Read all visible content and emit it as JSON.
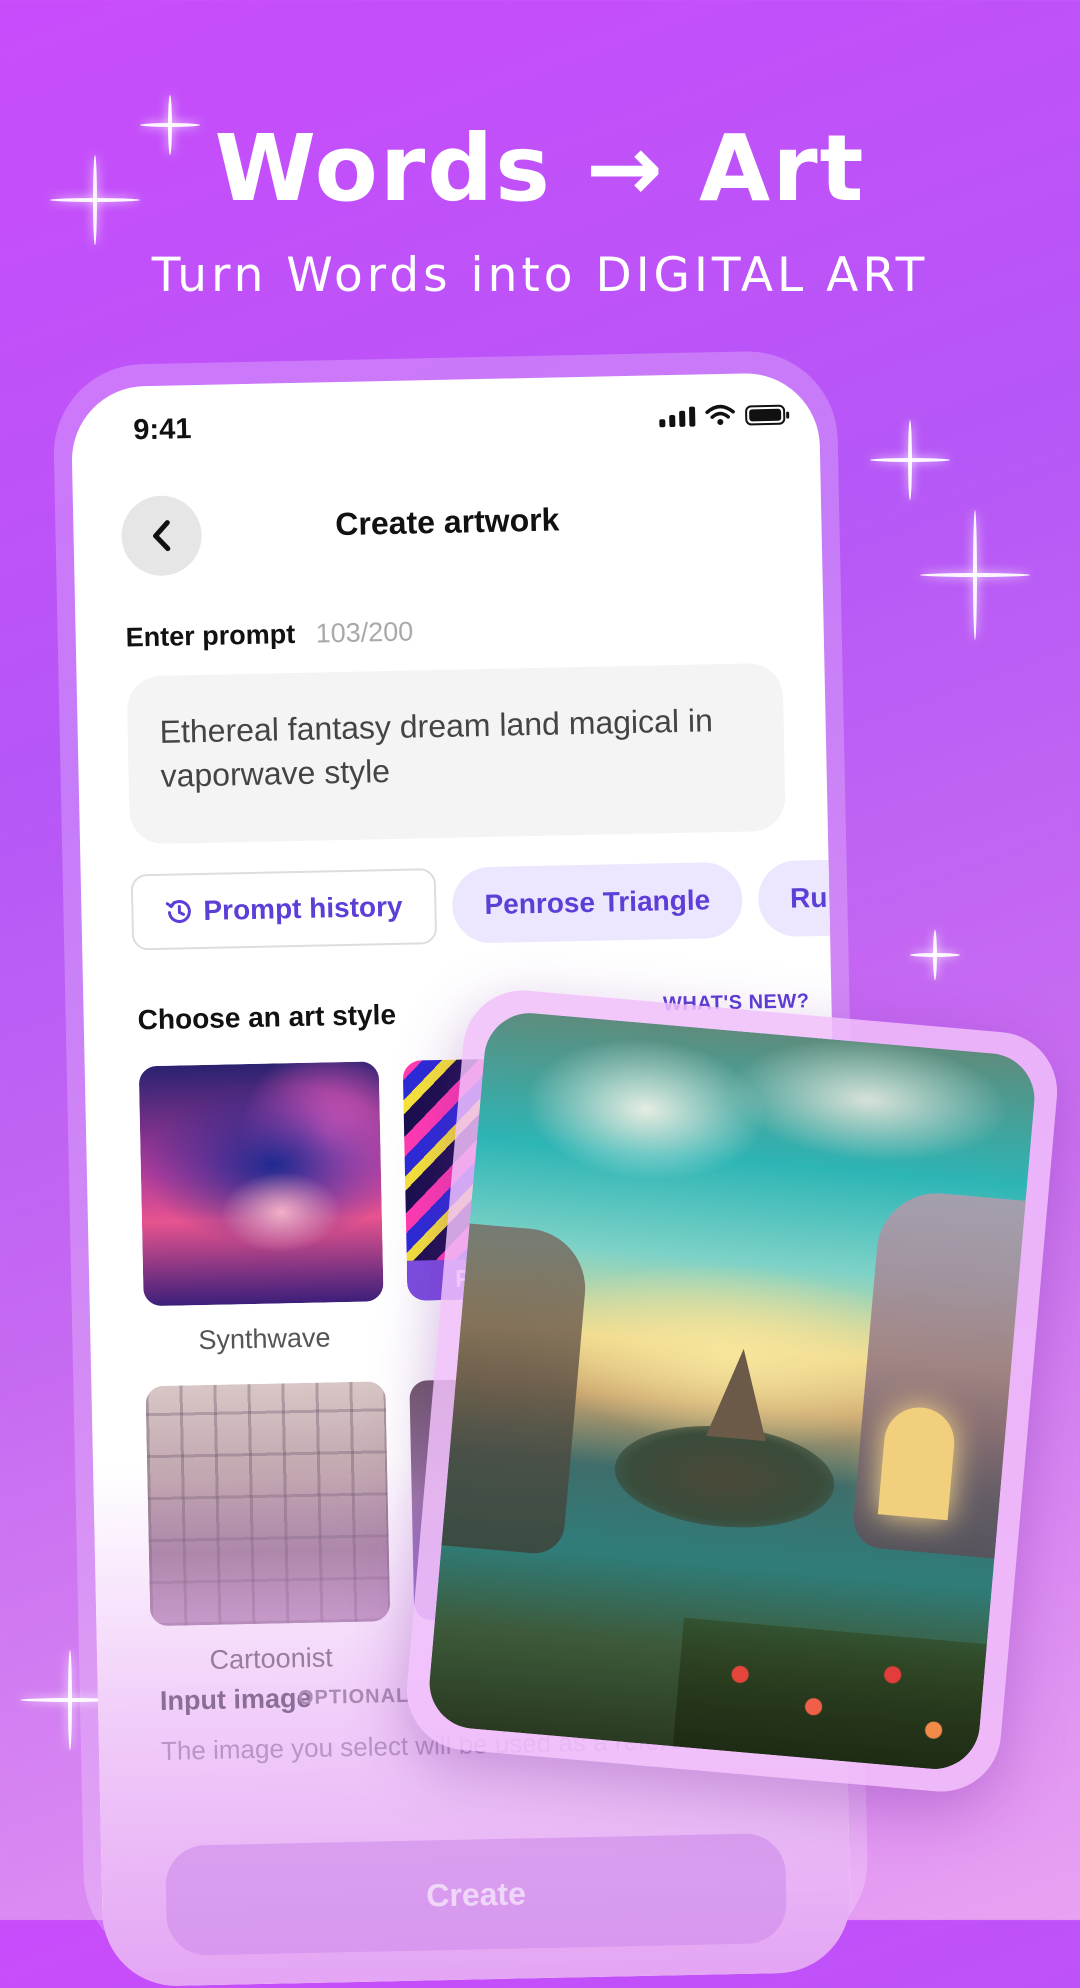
{
  "hero": {
    "title": "Words → Art",
    "subtitle": "Turn Words into DIGITAL ART"
  },
  "status_bar": {
    "time": "9:41"
  },
  "header": {
    "title": "Create artwork"
  },
  "prompt": {
    "label": "Enter prompt",
    "count": "103/200",
    "value": "Ethereal fantasy dream land magical in vaporwave style"
  },
  "chips": {
    "history": "Prompt history",
    "suggestion_1": "Penrose Triangle",
    "suggestion_2": "Ruii"
  },
  "styles": {
    "label": "Choose an art style",
    "whats_new": "WHAT'S NEW?",
    "items": [
      {
        "label": "Synthwave"
      },
      {
        "label": "P"
      },
      {
        "label": "Cartoonist"
      }
    ]
  },
  "input_image": {
    "label": "Input image",
    "optional": "OPTIONAL",
    "description": "The image you select will be used as a reference"
  },
  "create_button": "Create",
  "colors": {
    "accent": "#5d3ed6",
    "background_top": "#c94cfb",
    "background_bottom": "#e8a2f2"
  }
}
